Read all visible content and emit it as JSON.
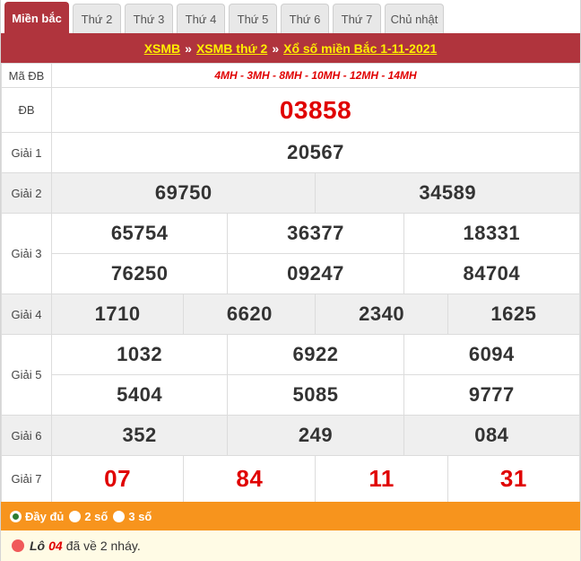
{
  "tabs": [
    "Miền bắc",
    "Thứ 2",
    "Thứ 3",
    "Thứ 4",
    "Thứ 5",
    "Thứ 6",
    "Thứ 7",
    "Chủ nhật"
  ],
  "header": {
    "link1": "XSMB",
    "sep1": "»",
    "link2": "XSMB thứ 2",
    "sep2": "»",
    "link3": "Xổ số miền Bắc 1-11-2021"
  },
  "ma_db": {
    "label": "Mã ĐB",
    "value": "4MH - 3MH - 8MH - 10MH - 12MH - 14MH"
  },
  "db": {
    "label": "ĐB",
    "value": "03858"
  },
  "giai1": {
    "label": "Giải 1",
    "values": [
      "20567"
    ]
  },
  "giai2": {
    "label": "Giải 2",
    "values": [
      "69750",
      "34589"
    ]
  },
  "giai3": {
    "label": "Giải 3",
    "values": [
      "65754",
      "36377",
      "18331",
      "76250",
      "09247",
      "84704"
    ]
  },
  "giai4": {
    "label": "Giải 4",
    "values": [
      "1710",
      "6620",
      "2340",
      "1625"
    ]
  },
  "giai5": {
    "label": "Giải 5",
    "values": [
      "1032",
      "6922",
      "6094",
      "5404",
      "5085",
      "9777"
    ]
  },
  "giai6": {
    "label": "Giải 6",
    "values": [
      "352",
      "249",
      "084"
    ]
  },
  "giai7": {
    "label": "Giải 7",
    "values": [
      "07",
      "84",
      "11",
      "31"
    ]
  },
  "options": {
    "full": "Đầy đủ",
    "two": "2 số",
    "three": "3 số"
  },
  "note": {
    "prefix": "Lô",
    "number": "04",
    "suffix": "đã về 2 nháy."
  },
  "colors": {
    "brand": "#b0343d",
    "link_yellow": "#ffef00",
    "accent_red": "#e00000",
    "option_bar": "#f7941d"
  }
}
